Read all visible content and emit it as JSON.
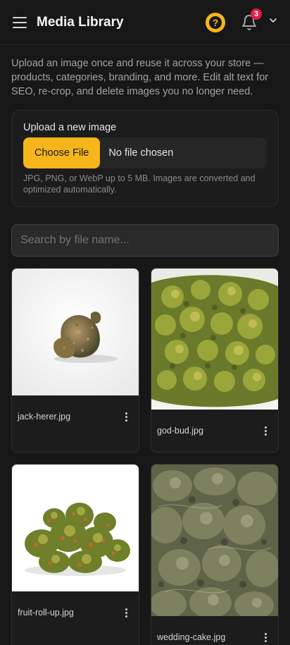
{
  "header": {
    "title": "Media Library",
    "help_label": "?",
    "notifications_count": "3"
  },
  "intro": "Upload an image once and reuse it across your store — products, categories, branding, and more. Edit alt text for SEO, re-crop, and delete images you no longer need.",
  "upload": {
    "label": "Upload a new image",
    "button_label": "Choose File",
    "status": "No file chosen",
    "hint": "JPG, PNG, or WebP up to 5 MB. Images are converted and optimized automatically."
  },
  "search": {
    "placeholder": "Search by file name..."
  },
  "images": [
    {
      "filename": "jack-herer.jpg"
    },
    {
      "filename": "god-bud.jpg"
    },
    {
      "filename": "fruit-roll-up.jpg"
    },
    {
      "filename": "wedding-cake.jpg"
    }
  ],
  "colors": {
    "accent": "#f5b51b",
    "badge": "#e11d48",
    "background": "#171717"
  }
}
